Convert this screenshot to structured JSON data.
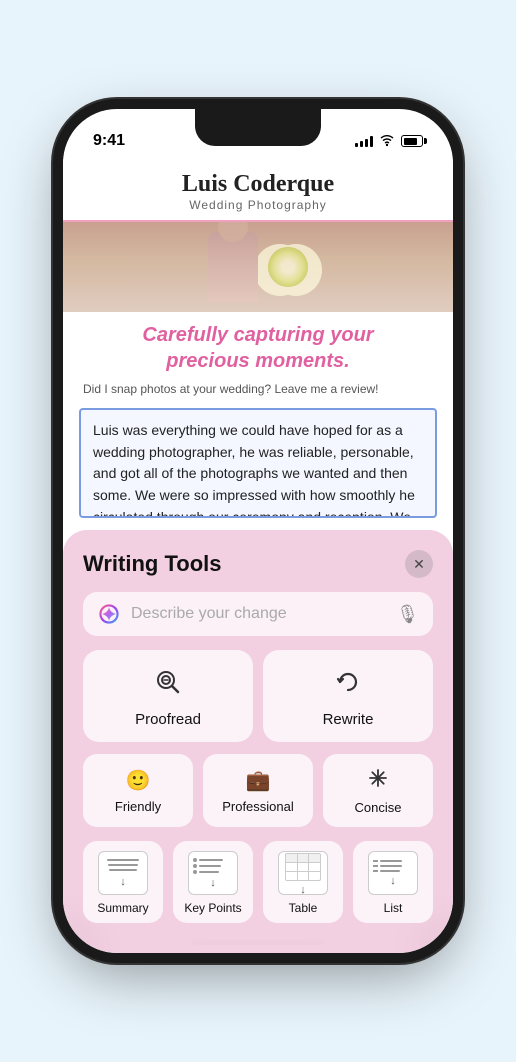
{
  "phone": {
    "statusBar": {
      "time": "9:41"
    },
    "website": {
      "siteName": "Luis Coderque",
      "siteSubtitle": "Wedding Photography",
      "tagline": "Carefully capturing your\nprecious moments.",
      "reviewPrompt": "Did I snap photos at your wedding? Leave me a review!",
      "reviewText": "Luis was everything we could have hoped for as a wedding photographer, he was reliable, personable, and got all of the photographs we wanted and then some. We were so impressed with how smoothly he circulated through our ceremony and reception. We barely realized he was there except when he was very"
    },
    "writingTools": {
      "title": "Writing Tools",
      "searchPlaceholder": "Describe your change",
      "mainActions": [
        {
          "id": "proofread",
          "label": "Proofread",
          "icon": "🔍"
        },
        {
          "id": "rewrite",
          "label": "Rewrite",
          "icon": "↻"
        }
      ],
      "toneActions": [
        {
          "id": "friendly",
          "label": "Friendly",
          "icon": "🙂"
        },
        {
          "id": "professional",
          "label": "Professional",
          "icon": "💼"
        },
        {
          "id": "concise",
          "label": "Concise",
          "icon": "✳"
        }
      ],
      "formatActions": [
        {
          "id": "summary",
          "label": "Summary"
        },
        {
          "id": "key-points",
          "label": "Key Points"
        },
        {
          "id": "table",
          "label": "Table"
        },
        {
          "id": "list",
          "label": "List"
        }
      ]
    }
  }
}
